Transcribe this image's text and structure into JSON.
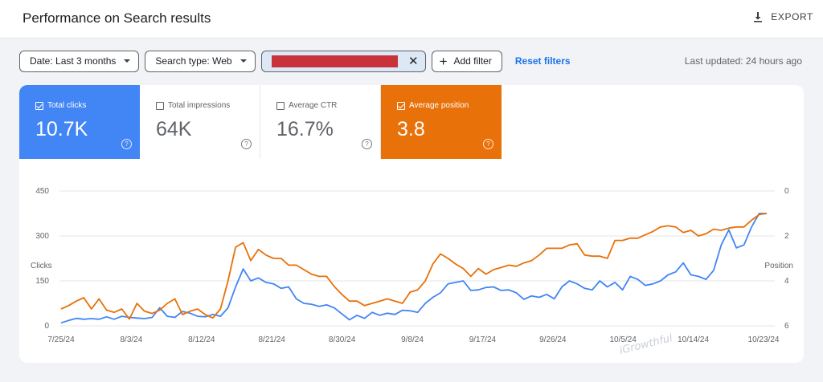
{
  "header": {
    "title": "Performance on Search results",
    "export_label": "EXPORT"
  },
  "filters": {
    "date_label": "Date: Last 3 months",
    "search_type_label": "Search type: Web",
    "query_value": "",
    "add_filter_label": "Add filter",
    "reset_label": "Reset filters",
    "last_updated": "Last updated: 24 hours ago"
  },
  "colors": {
    "clicks": "#4285f4",
    "position": "#e8710a",
    "redaction": "#c8323b",
    "link": "#1a73e8"
  },
  "metrics": [
    {
      "label": "Total clicks",
      "value": "10.7K",
      "checked": true
    },
    {
      "label": "Total impressions",
      "value": "64K",
      "checked": false
    },
    {
      "label": "Average CTR",
      "value": "16.7%",
      "checked": false
    },
    {
      "label": "Average position",
      "value": "3.8",
      "checked": true
    }
  ],
  "chart_data": {
    "type": "line",
    "left_axis": {
      "label": "Clicks",
      "ticks": [
        "450",
        "300",
        "150",
        "0"
      ],
      "range": [
        0,
        450
      ]
    },
    "right_axis": {
      "label": "Position",
      "ticks": [
        "0",
        "2",
        "4",
        "6"
      ],
      "range": [
        0,
        6
      ],
      "inverted": true
    },
    "x_ticks": [
      "7/25/24",
      "8/3/24",
      "8/12/24",
      "8/21/24",
      "8/30/24",
      "9/8/24",
      "9/17/24",
      "9/26/24",
      "10/5/24",
      "10/14/24",
      "10/23/24"
    ],
    "grid": true,
    "watermark": "iGrowthful",
    "series": [
      {
        "axis": "left",
        "values": [
          10,
          18,
          25,
          22,
          24,
          22,
          30,
          22,
          32,
          28,
          26,
          24,
          28,
          60,
          32,
          28,
          48,
          42,
          32,
          30,
          38,
          32,
          60,
          130,
          190,
          150,
          160,
          145,
          140,
          125,
          130,
          90,
          75,
          72,
          65,
          70,
          60,
          40,
          20,
          35,
          25,
          45,
          35,
          42,
          38,
          52,
          50,
          45,
          75,
          95,
          110,
          140,
          145,
          150,
          118,
          120,
          128,
          130,
          118,
          120,
          110,
          88,
          100,
          95,
          105,
          90,
          130,
          150,
          140,
          125,
          120,
          150,
          130,
          145,
          120,
          165,
          155,
          135,
          140,
          150,
          170,
          180,
          210,
          170,
          165,
          155,
          185,
          270,
          320,
          260,
          270,
          330,
          375,
          375
        ]
      },
      {
        "axis": "right",
        "values": [
          5.25,
          5.1,
          4.9,
          4.75,
          5.25,
          4.8,
          5.3,
          5.4,
          5.25,
          5.7,
          5.0,
          5.35,
          5.45,
          5.3,
          5.0,
          4.8,
          5.5,
          5.35,
          5.25,
          5.5,
          5.65,
          5.25,
          4.0,
          2.5,
          2.3,
          3.1,
          2.6,
          2.85,
          3.0,
          3.0,
          3.3,
          3.3,
          3.5,
          3.7,
          3.8,
          3.8,
          4.25,
          4.6,
          4.9,
          4.9,
          5.1,
          5.0,
          4.9,
          4.8,
          4.9,
          5.0,
          4.5,
          4.4,
          4.0,
          3.25,
          2.8,
          3.0,
          3.25,
          3.45,
          3.8,
          3.45,
          3.7,
          3.5,
          3.4,
          3.3,
          3.35,
          3.2,
          3.1,
          2.85,
          2.55,
          2.55,
          2.55,
          2.4,
          2.35,
          2.85,
          2.9,
          2.9,
          3.0,
          2.2,
          2.2,
          2.1,
          2.1,
          1.95,
          1.8,
          1.6,
          1.55,
          1.6,
          1.85,
          1.75,
          2.0,
          1.9,
          1.7,
          1.75,
          1.65,
          1.6,
          1.6,
          1.3,
          1.05,
          1.0
        ]
      }
    ]
  }
}
